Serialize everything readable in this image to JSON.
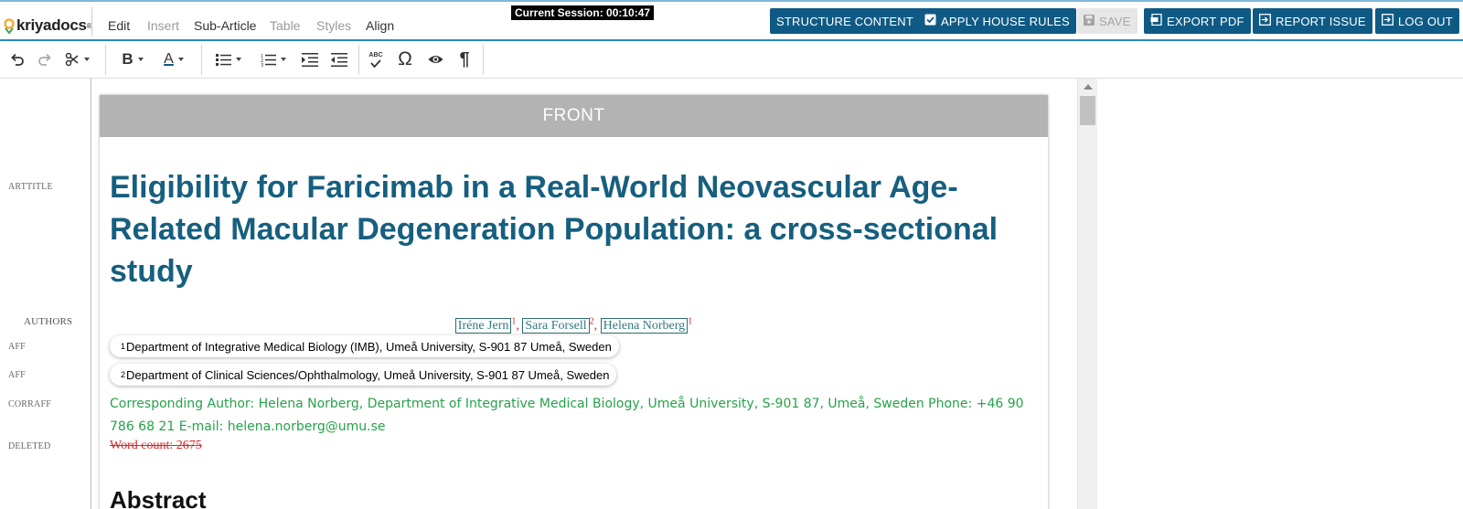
{
  "header": {
    "logo_text": "kriyadocs",
    "logo_reg": "®",
    "menus": [
      {
        "label": "Edit",
        "enabled": true
      },
      {
        "label": "Insert",
        "enabled": false
      },
      {
        "label": "Sub-Article",
        "enabled": true
      },
      {
        "label": "Table",
        "enabled": false
      },
      {
        "label": "Styles",
        "enabled": false
      },
      {
        "label": "Align",
        "enabled": true
      }
    ],
    "session": "Current Session: 00:10:47",
    "buttons": [
      {
        "label": "STRUCTURE CONTENT",
        "icon": "",
        "enabled": true
      },
      {
        "label": "APPLY HOUSE RULES",
        "icon": "checkbox-icon",
        "enabled": true
      },
      {
        "label": "SAVE",
        "icon": "floppy-icon",
        "enabled": false
      },
      {
        "label": "EXPORT PDF",
        "icon": "pdf-icon",
        "enabled": true
      },
      {
        "label": "REPORT ISSUE",
        "icon": "report-icon",
        "enabled": true
      },
      {
        "label": "LOG OUT",
        "icon": "logout-icon",
        "enabled": true
      }
    ],
    "accent_color": "#0f5a85"
  },
  "toolbar": {
    "tools": [
      "undo-icon",
      "redo-icon",
      "cut-icon",
      "bold-icon",
      "font-color-icon",
      "bullet-list-icon",
      "numbered-list-icon",
      "indent-icon",
      "outdent-icon",
      "spellcheck-icon",
      "omega-icon",
      "eye-icon",
      "pilcrow-icon"
    ],
    "spellcheck_text": "ABC",
    "bold_text": "B",
    "font_color_text": "A",
    "omega_text": "Ω",
    "pilcrow_text": "¶"
  },
  "gutter": {
    "labels": [
      "ARTTITLE",
      "AUTHORS",
      "AFF",
      "AFF",
      "CORRAFF",
      "DELETED"
    ]
  },
  "document": {
    "section_header": "FRONT",
    "title": "Eligibility for Faricimab in a Real-World Neovascular Age-Related Macular Degeneration Population: a cross-sectional study",
    "authors": [
      {
        "name": "Iréne Jern",
        "aff": "1"
      },
      {
        "name": "Sara Forsell",
        "aff": "2"
      },
      {
        "name": "Helena Norberg",
        "aff": "1"
      }
    ],
    "affiliations": [
      {
        "num": "1",
        "text": "Department of Integrative Medical Biology (IMB), Umeå University, S-901 87 Umeå, Sweden"
      },
      {
        "num": "2",
        "text": "Department of Clinical Sciences/Ophthalmology, Umeå University, S-901 87 Umeå, Sweden"
      }
    ],
    "corresponding": "Corresponding Author: Helena Norberg, Department of Integrative Medical Biology, Umeå University, S-901 87, Umeå, Sweden Phone: +46 90 786 68 21 E-mail: helena.norberg@umu.se",
    "deleted": "Word count: 2675",
    "next_heading": "Abstract"
  }
}
